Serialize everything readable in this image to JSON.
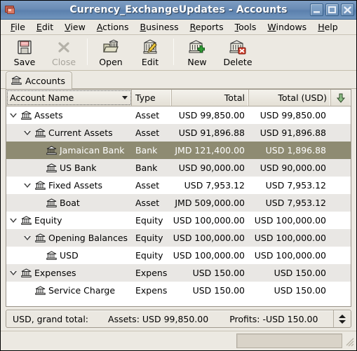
{
  "window": {
    "title": "Currency_ExchangeUpdates - Accounts",
    "icon": "accounts-app-icon",
    "buttons": {
      "minimize": "minimize-button",
      "maximize": "maximize-button",
      "close": "close-button"
    }
  },
  "menubar": {
    "items": [
      {
        "label": "File",
        "mnemonic": "F"
      },
      {
        "label": "Edit",
        "mnemonic": "E"
      },
      {
        "label": "View",
        "mnemonic": "V"
      },
      {
        "label": "Actions",
        "mnemonic": "A"
      },
      {
        "label": "Business",
        "mnemonic": "B"
      },
      {
        "label": "Reports",
        "mnemonic": "R"
      },
      {
        "label": "Tools",
        "mnemonic": "T"
      },
      {
        "label": "Windows",
        "mnemonic": "W"
      },
      {
        "label": "Help",
        "mnemonic": "H"
      }
    ]
  },
  "toolbar": {
    "buttons": [
      {
        "label": "Save",
        "icon": "save-floppy-icon",
        "enabled": true
      },
      {
        "label": "Close",
        "icon": "close-x-icon",
        "enabled": false
      },
      {
        "label": "Open",
        "icon": "open-folder-icon",
        "enabled": true
      },
      {
        "label": "Edit",
        "icon": "edit-pencil-icon",
        "enabled": true
      },
      {
        "label": "New",
        "icon": "new-plus-icon",
        "enabled": true
      },
      {
        "label": "Delete",
        "icon": "delete-x-icon",
        "enabled": true
      }
    ]
  },
  "tabs": [
    {
      "label": "Accounts",
      "icon": "bank-icon",
      "active": true
    }
  ],
  "table": {
    "columns": [
      {
        "label": "Account Name",
        "align": "left",
        "sortable": true,
        "focused": true
      },
      {
        "label": "Type",
        "align": "left",
        "sortable": true,
        "focused": false
      },
      {
        "label": "Total",
        "align": "right",
        "sortable": true,
        "focused": false
      },
      {
        "label": "Total (USD)",
        "align": "right",
        "sortable": true,
        "focused": false
      }
    ],
    "options_button": "column-options-icon",
    "rows": [
      {
        "name": "Assets",
        "depth": 0,
        "expandable": true,
        "expanded": true,
        "type": "Asset",
        "total": "USD 99,850.00",
        "total_usd": "USD 99,850.00",
        "selected": false
      },
      {
        "name": "Current Assets",
        "depth": 1,
        "expandable": true,
        "expanded": true,
        "type": "Asset",
        "total": "USD 91,896.88",
        "total_usd": "USD 91,896.88",
        "selected": false
      },
      {
        "name": "Jamaican Bank",
        "depth": 2,
        "expandable": false,
        "expanded": false,
        "type": "Bank",
        "total": "JMD 121,400.00",
        "total_usd": "USD 1,896.88",
        "selected": true
      },
      {
        "name": "US Bank",
        "depth": 2,
        "expandable": false,
        "expanded": false,
        "type": "Bank",
        "total": "USD 90,000.00",
        "total_usd": "USD 90,000.00",
        "selected": false
      },
      {
        "name": "Fixed Assets",
        "depth": 1,
        "expandable": true,
        "expanded": true,
        "type": "Asset",
        "total": "USD 7,953.12",
        "total_usd": "USD 7,953.12",
        "selected": false
      },
      {
        "name": "Boat",
        "depth": 2,
        "expandable": false,
        "expanded": false,
        "type": "Asset",
        "total": "JMD 509,000.00",
        "total_usd": "USD 7,953.12",
        "selected": false
      },
      {
        "name": "Equity",
        "depth": 0,
        "expandable": true,
        "expanded": true,
        "type": "Equity",
        "total": "USD 100,000.00",
        "total_usd": "USD 100,000.00",
        "selected": false
      },
      {
        "name": "Opening Balances",
        "depth": 1,
        "expandable": true,
        "expanded": true,
        "type": "Equity",
        "total": "USD 100,000.00",
        "total_usd": "USD 100,000.00",
        "selected": false
      },
      {
        "name": "USD",
        "depth": 2,
        "expandable": false,
        "expanded": false,
        "type": "Equity",
        "total": "USD 100,000.00",
        "total_usd": "USD 100,000.00",
        "selected": false
      },
      {
        "name": "Expenses",
        "depth": 0,
        "expandable": true,
        "expanded": true,
        "type": "Expens",
        "total": "USD 150.00",
        "total_usd": "USD 150.00",
        "selected": false
      },
      {
        "name": "Service Charge",
        "depth": 1,
        "expandable": false,
        "expanded": false,
        "type": "Expens",
        "total": "USD 150.00",
        "total_usd": "USD 150.00",
        "selected": false
      }
    ]
  },
  "summary": {
    "label": "USD, grand total:",
    "assets": "Assets: USD 99,850.00",
    "profits": "Profits: -USD 150.00",
    "spinner": "summary-spinner"
  },
  "statusbar": {
    "text": "",
    "progress": "progress-bar",
    "grip": "resize-grip-icon"
  },
  "colors": {
    "titlebar": "#6a8cb5",
    "selection": "#8e8b72",
    "chrome": "#ece9e2",
    "row_alt": "#e9e7e4"
  }
}
